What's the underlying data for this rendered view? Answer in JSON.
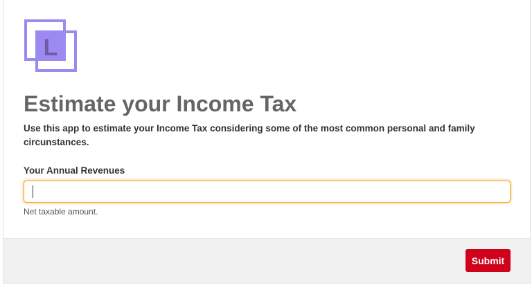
{
  "logo": {
    "letter": "L",
    "icon": "l-logo-icon",
    "frame_color": "#9b8af0",
    "inner_color": "#7557a8"
  },
  "header": {
    "title": "Estimate your Income Tax",
    "description": "Use this app to estimate your Income Tax considering some of the most common personal and family circunstances."
  },
  "form": {
    "revenues_label": "Your Annual Revenues",
    "revenues_value": "",
    "revenues_help": "Net taxable amount."
  },
  "footer": {
    "submit_label": "Submit"
  },
  "colors": {
    "accent": "#d0021b",
    "focus": "#f5a623",
    "title": "#656565"
  }
}
